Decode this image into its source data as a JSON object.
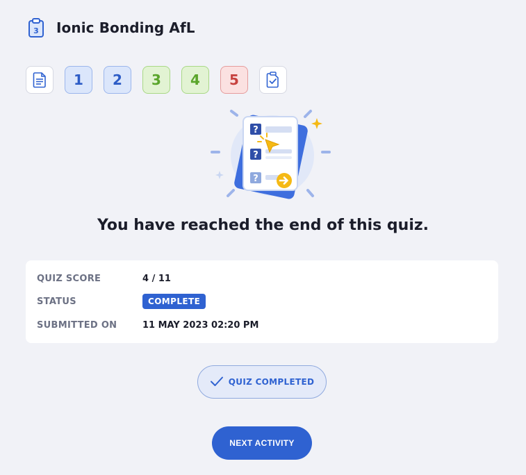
{
  "header": {
    "title": "Ionic Bonding AfL",
    "icon": "clipboard-quiz-icon",
    "icon_number": "3"
  },
  "question_nav": {
    "intro_icon": "document-icon",
    "items": [
      {
        "label": "1",
        "state": "unanswered",
        "color": "#2d5cc6"
      },
      {
        "label": "2",
        "state": "unanswered",
        "color": "#2d5cc6"
      },
      {
        "label": "3",
        "state": "correct",
        "color": "#5aa52b"
      },
      {
        "label": "4",
        "state": "correct",
        "color": "#5aa52b"
      },
      {
        "label": "5",
        "state": "incorrect",
        "color": "#c7423f"
      }
    ],
    "summary_icon": "clipboard-check-icon"
  },
  "illustration": {
    "icon": "quiz-end-illustration",
    "question_mark": "?"
  },
  "end_message": "You have reached the end of this quiz.",
  "score_card": {
    "quiz_score_label": "QUIZ SCORE",
    "quiz_score_value": "4 / 11",
    "status_label": "STATUS",
    "status_value": "COMPLETE",
    "submitted_label": "SUBMITTED ON",
    "submitted_value": "11 MAY 2023 02:20 PM"
  },
  "actions": {
    "quiz_completed_label": "QUIZ COMPLETED",
    "next_activity_label": "NEXT ACTIVITY"
  },
  "colors": {
    "accent": "#2f62d1",
    "background": "#f1f2f7",
    "correct": "#5aa52b",
    "incorrect": "#c7423f"
  }
}
